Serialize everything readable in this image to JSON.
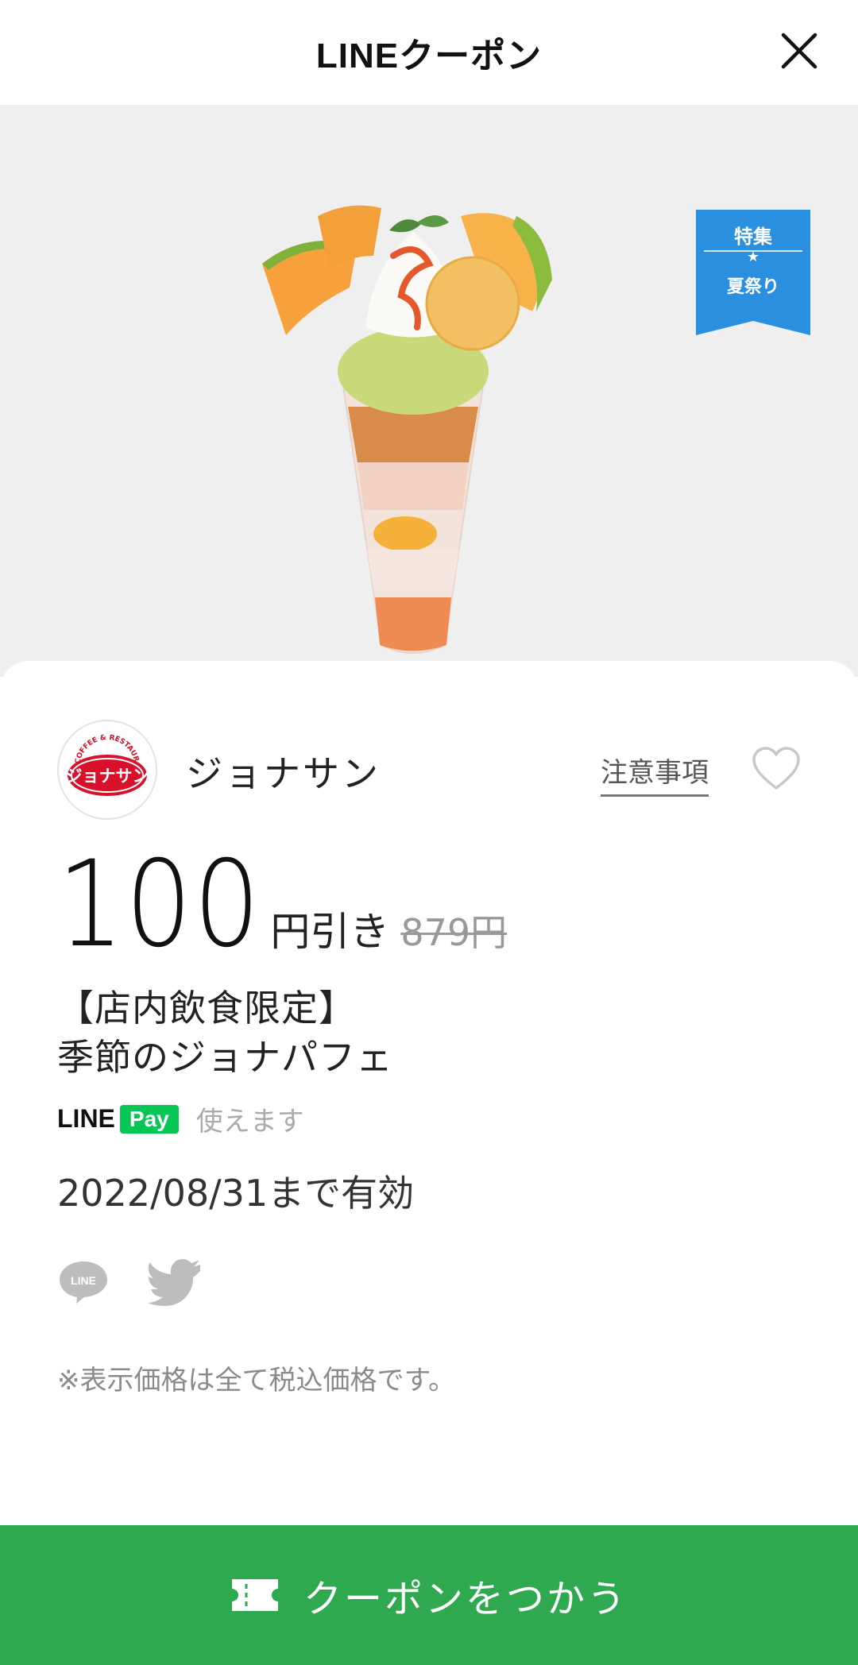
{
  "header": {
    "title": "LINEクーポン",
    "close_icon": "close-icon"
  },
  "hero": {
    "image": "seasonal-parfait-photo",
    "tag": {
      "line1": "特集",
      "star": "★",
      "line2": "夏祭り",
      "color": "#2b8fe0"
    }
  },
  "store": {
    "logo_text": "ジョナサン",
    "logo_subtext": "COFFEE & RESTAURANT",
    "name": "ジョナサン",
    "notes_label": "注意事項",
    "favorite_icon": "heart-icon"
  },
  "discount": {
    "amount": "100",
    "unit": "円引き",
    "original_price": "879円"
  },
  "item": {
    "title_line1": "【店内飲食限定】",
    "title_line2": "季節のジョナパフェ"
  },
  "payment": {
    "line_label": "LINE",
    "pay_label": "Pay",
    "usable_text": "使えます"
  },
  "valid_until": "2022/08/31まで有効",
  "share": {
    "line_icon": "line-share-icon",
    "line_icon_text": "LINE",
    "twitter_icon": "twitter-icon"
  },
  "tax_note": "※表示価格は全て税込価格です。",
  "use_button": {
    "label": "クーポンをつかう",
    "icon": "ticket-icon",
    "color": "#2ea94f"
  }
}
